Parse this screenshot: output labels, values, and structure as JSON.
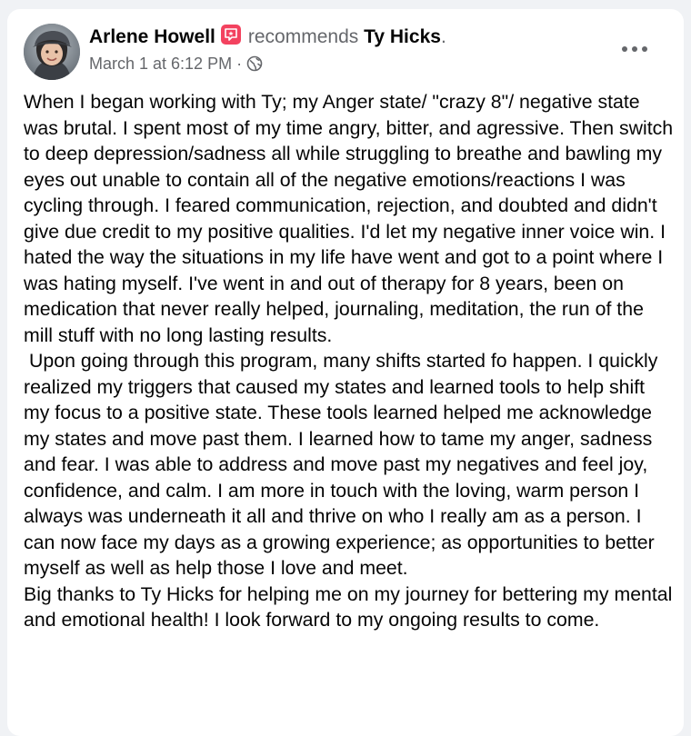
{
  "post": {
    "author": "Arlene Howell",
    "action": "recommends",
    "page": "Ty Hicks",
    "period": ".",
    "timestamp": "March 1 at 6:12 PM",
    "separator": "·",
    "privacy_icon": "globe-icon",
    "more_icon": "ellipsis-icon",
    "badge_icon": "recommendation-flag-icon",
    "paragraphs": [
      "When I began working with Ty; my Anger state/ \"crazy 8\"/ negative state was brutal. I spent most of my time angry, bitter, and agressive. Then switch to deep depression/sadness all while struggling to breathe and bawling my eyes out unable to contain all of the negative emotions/reactions I was cycling through. I feared communication, rejection, and doubted and didn't give due credit to my positive qualities. I'd let my negative inner voice win. I hated the way the situations in my life have went and got to a point where I was hating myself. I've went in and out of therapy for 8 years, been on medication that never really helped, journaling, meditation, the run of the mill stuff with no long lasting results.",
      "Upon going through this program, many shifts started fo happen. I quickly realized my triggers that caused my states and learned tools to help shift my focus to a positive state. These tools learned helped me acknowledge my states and move past them. I learned how to tame my anger, sadness and fear. I was able to address and move past my negatives and feel joy, confidence, and calm. I am more in touch with the loving, warm person I always was underneath it all and thrive on who I really am as a person. I can now face my days as a growing experience; as opportunities to better myself as well as help those I love and meet.",
      "Big thanks to Ty Hicks for helping me on my journey for bettering my mental and emotional health! I look forward to my ongoing results to come."
    ]
  },
  "colors": {
    "page_background": "#f0f2f5",
    "card_background": "#ffffff",
    "primary_text": "#050505",
    "secondary_text": "#65676b",
    "badge": "#f3425f"
  }
}
